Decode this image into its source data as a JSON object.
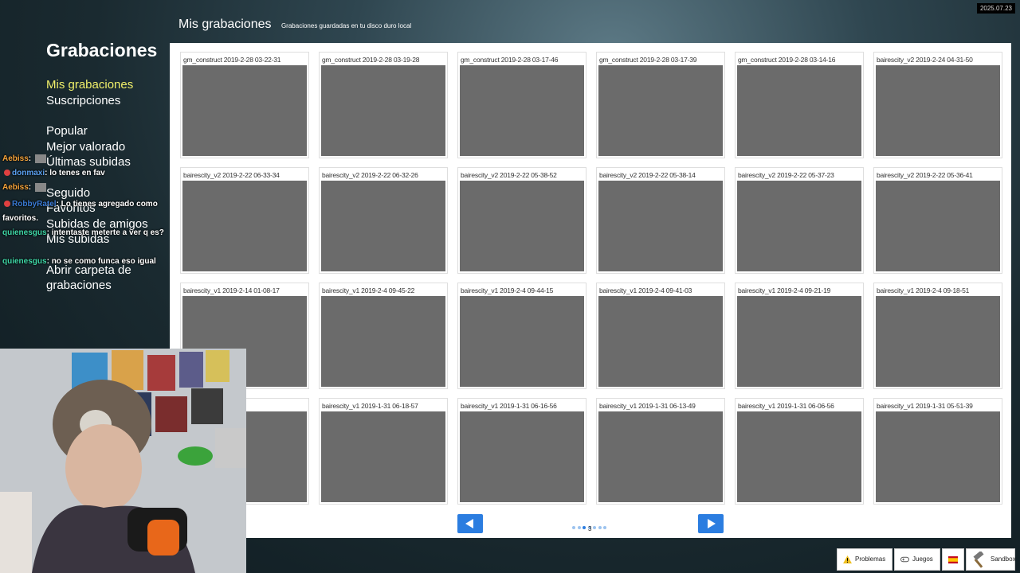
{
  "date_stamp": "2025.07.23",
  "sidebar": {
    "title": "Grabaciones",
    "items": [
      {
        "label": "Mis grabaciones",
        "active": true
      },
      {
        "label": "Suscripciones"
      },
      {
        "label": "Popular"
      },
      {
        "label": "Mejor valorado"
      },
      {
        "label": "Últimas subidas"
      },
      {
        "label": "Seguido"
      },
      {
        "label": "Favoritos"
      },
      {
        "label": "Subidas de amigos"
      },
      {
        "label": "Mis subidas"
      },
      {
        "label": "Abrir carpeta de grabaciones"
      }
    ]
  },
  "chat": [
    {
      "user": "Aebiss",
      "user_color": "#f3a23a",
      "text": ""
    },
    {
      "user": "donmaxi",
      "user_color": "#5aa0f0",
      "text": "lo tenes en fav"
    },
    {
      "user": "Aebiss",
      "user_color": "#f3a23a",
      "text": ""
    },
    {
      "user": "RobbyRatel",
      "user_color": "#3a7bd5",
      "text": "Lo tienes agregado como favoritos."
    },
    {
      "user": "quienesgus",
      "user_color": "#3fd8a8",
      "text": "intentaste meterte a ver q es?"
    },
    {
      "user": "quienesgus",
      "user_color": "#3fd8a8",
      "text": "no se como funca eso igual"
    }
  ],
  "header": {
    "title": "Mis grabaciones",
    "subtitle": "Grabaciones guardadas en tu disco duro local"
  },
  "recordings": [
    "gm_construct 2019-2-28 03-22-31",
    "gm_construct 2019-2-28 03-19-28",
    "gm_construct 2019-2-28 03-17-46",
    "gm_construct 2019-2-28 03-17-39",
    "gm_construct 2019-2-28 03-14-16",
    "bairescity_v2 2019-2-24 04-31-50",
    "bairescity_v2 2019-2-22 06-33-34",
    "bairescity_v2 2019-2-22 06-32-26",
    "bairescity_v2 2019-2-22 05-38-52",
    "bairescity_v2 2019-2-22 05-38-14",
    "bairescity_v2 2019-2-22 05-37-23",
    "bairescity_v2 2019-2-22 05-36-41",
    "bairescity_v1 2019-2-14 01-08-17",
    "bairescity_v1 2019-2-4 09-45-22",
    "bairescity_v1 2019-2-4 09-44-15",
    "bairescity_v1 2019-2-4 09-41-03",
    "bairescity_v1 2019-2-4 09-21-19",
    "bairescity_v1 2019-2-4 09-18-51",
    "-4 09-00-32",
    "bairescity_v1 2019-1-31 06-18-57",
    "bairescity_v1 2019-1-31 06-16-56",
    "bairescity_v1 2019-1-31 06-13-49",
    "bairescity_v1 2019-1-31 06-06-56",
    "bairescity_v1 2019-1-31 05-51-39"
  ],
  "pagination": {
    "current_page": "3",
    "total_dots": 7,
    "active_dot": 3
  },
  "bottom_bar": [
    {
      "label": "Problemas",
      "icon": "warning-icon"
    },
    {
      "label": "Juegos",
      "icon": "gamepad-icon"
    },
    {
      "label": "",
      "icon": "spain-flag-icon"
    },
    {
      "label": "Sandbox",
      "icon": "hammer-icon"
    }
  ]
}
